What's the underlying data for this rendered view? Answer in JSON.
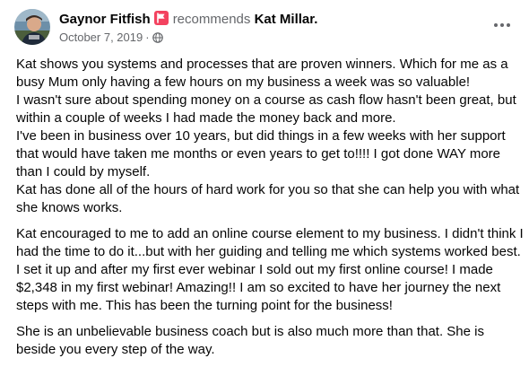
{
  "post": {
    "author": "Gaynor Fitfish",
    "verb": "recommends",
    "page": "Kat Millar.",
    "date": "October 7, 2019",
    "separator": "·",
    "privacy_icon": "globe-icon",
    "recommend_icon": "recommend-flag-icon",
    "more_icon": "more-options-icon",
    "paragraphs": [
      "Kat shows you systems and processes that are proven winners. Which for me as a busy Mum only having a few hours on my business a week was so valuable!\nI wasn't sure about spending money on a course as cash flow hasn't been great, but within a couple of weeks I had made the money back and more.\nI've been in business over 10 years, but did things in a few weeks with her support that would have taken me months or even years to get to!!!! I got done WAY more than I could by myself.\nKat has done all of the hours of hard work for you so that she can help you with what she knows works.",
      "Kat encouraged to me to add an online course element to my business. I didn't think I had the time to do it...but with her guiding and telling me which systems worked best. I set it up and after my first ever webinar I sold out my first online course! I made $2,348 in my first webinar! Amazing!! I am so excited to have her journey the next steps with me. This has been the turning point for the business!",
      "She is an unbelievable business coach but is also much more than that. She is beside you every step of the way."
    ]
  },
  "colors": {
    "text_primary": "#050505",
    "text_secondary": "#65676b",
    "badge_red": "#f3425f",
    "background": "#ffffff"
  }
}
